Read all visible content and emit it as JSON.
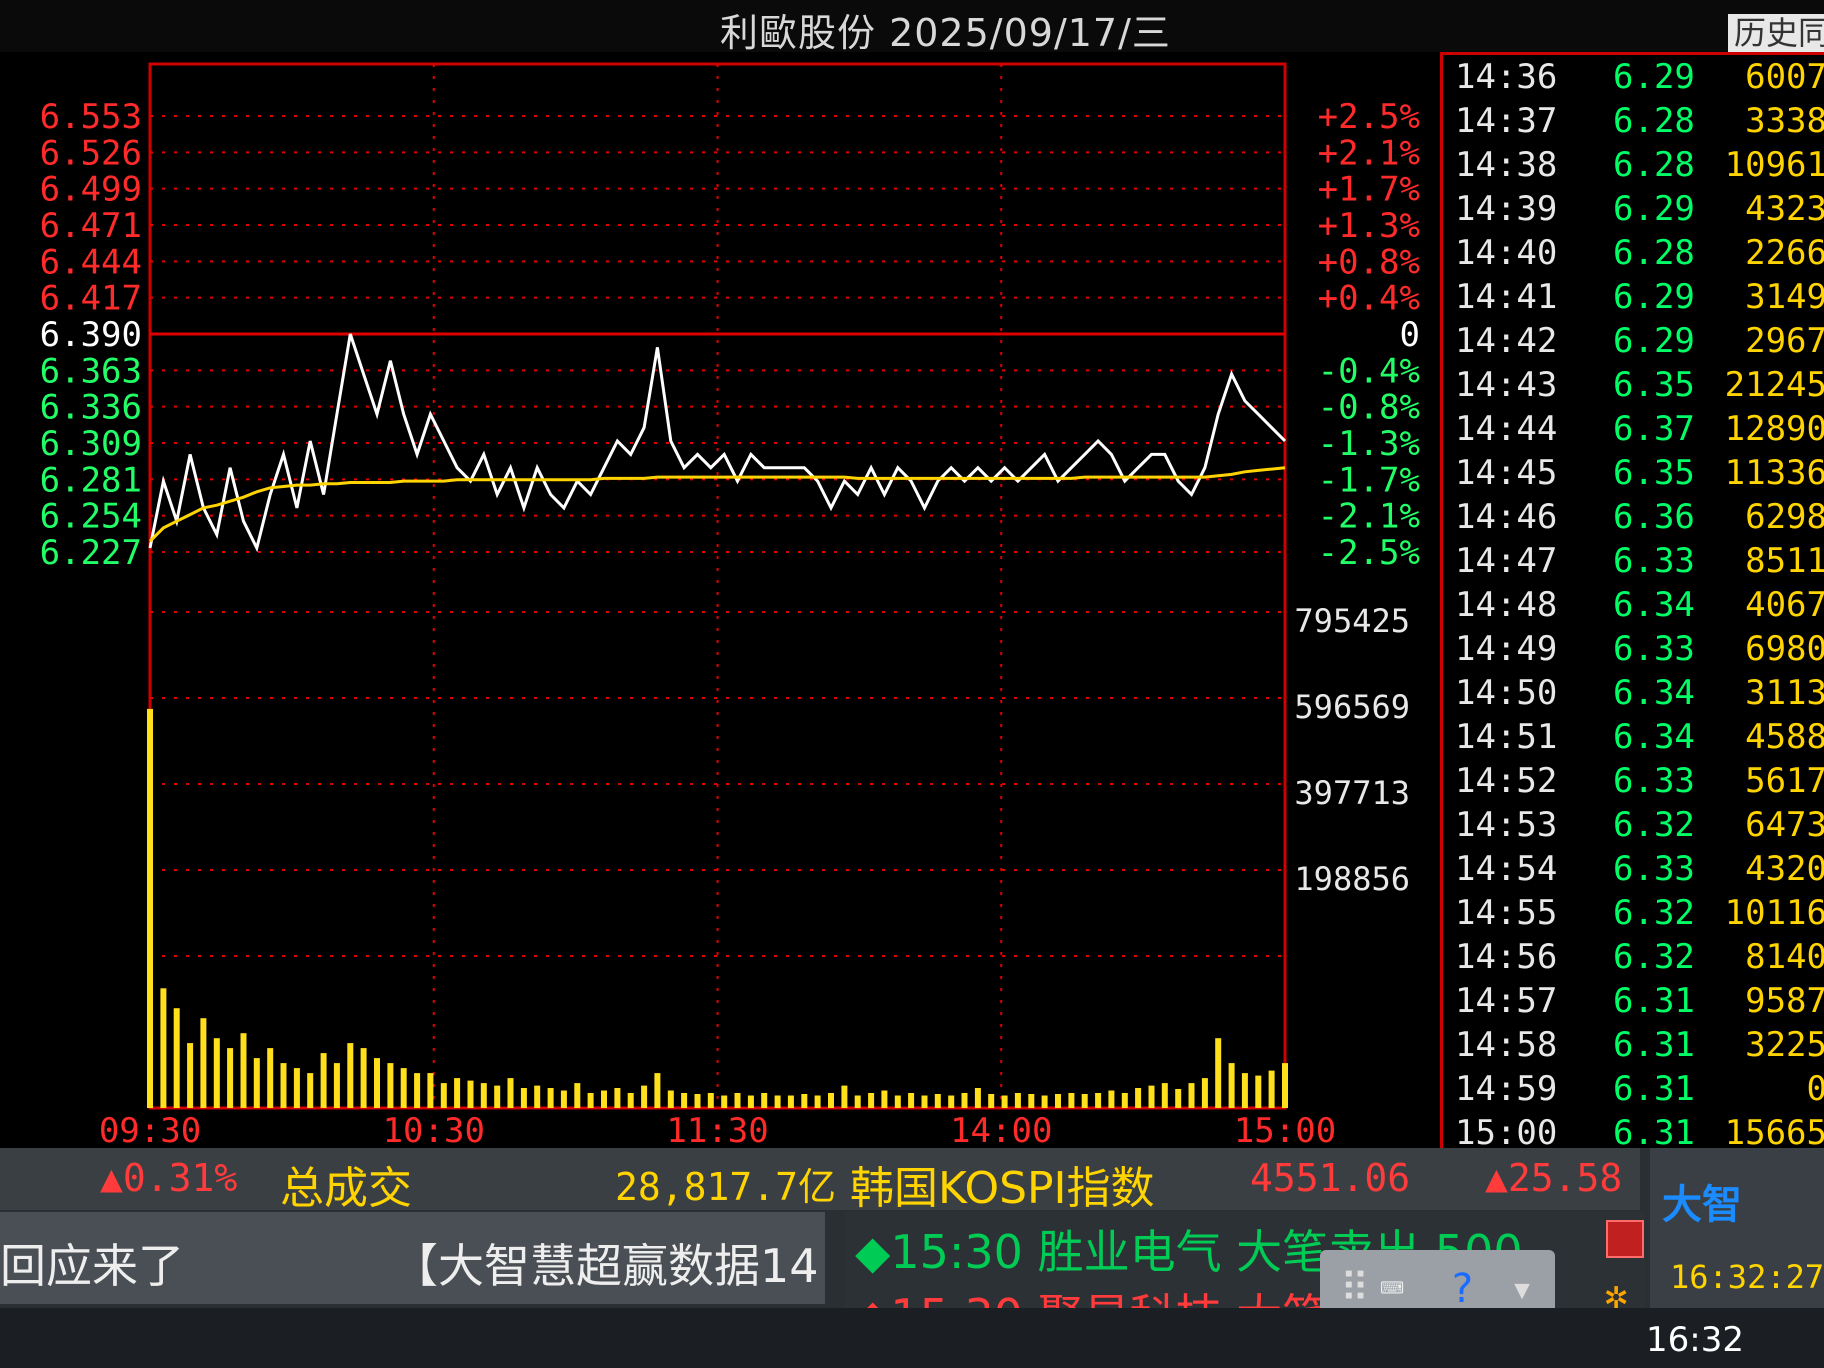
{
  "header": {
    "title": "利歐股份 2025/09/17/三",
    "history_tab": "历史同"
  },
  "chart_data": {
    "type": "line",
    "title": "利歐股份 2025/09/17/三",
    "prev_close": 6.39,
    "price_axis_left": {
      "up": [
        "6.553",
        "6.526",
        "6.499",
        "6.471",
        "6.444",
        "6.417"
      ],
      "ref": "6.390",
      "down": [
        "6.363",
        "6.336",
        "6.309",
        "6.281",
        "6.254",
        "6.227"
      ]
    },
    "pct_axis_right": {
      "up": [
        "+2.5%",
        "+2.1%",
        "+1.7%",
        "+1.3%",
        "+0.8%",
        "+0.4%"
      ],
      "ref": "0",
      "down": [
        "-0.4%",
        "-0.8%",
        "-1.3%",
        "-1.7%",
        "-2.1%",
        "-2.5%"
      ]
    },
    "volume_axis": [
      "795425",
      "596569",
      "397713",
      "198856"
    ],
    "x_labels": [
      "09:30",
      "10:30",
      "11:30",
      "14:00",
      "15:00"
    ],
    "ylim": [
      6.227,
      6.553
    ],
    "volume_max": 994281,
    "series": [
      {
        "color": "#ffffff",
        "values": [
          6.23,
          6.28,
          6.25,
          6.3,
          6.26,
          6.24,
          6.29,
          6.25,
          6.23,
          6.27,
          6.3,
          6.26,
          6.31,
          6.27,
          6.33,
          6.39,
          6.36,
          6.33,
          6.37,
          6.33,
          6.3,
          6.33,
          6.31,
          6.29,
          6.28,
          6.3,
          6.27,
          6.29,
          6.26,
          6.29,
          6.27,
          6.26,
          6.28,
          6.27,
          6.29,
          6.31,
          6.3,
          6.32,
          6.38,
          6.31,
          6.29,
          6.3,
          6.29,
          6.3,
          6.28,
          6.3,
          6.29,
          6.29,
          6.29,
          6.29,
          6.28,
          6.26,
          6.28,
          6.27,
          6.29,
          6.27,
          6.29,
          6.28,
          6.26,
          6.28,
          6.29,
          6.28,
          6.29,
          6.28,
          6.29,
          6.28,
          6.29,
          6.3,
          6.28,
          6.29,
          6.3,
          6.31,
          6.3,
          6.28,
          6.29,
          6.3,
          6.3,
          6.28,
          6.27,
          6.29,
          6.33,
          6.36,
          6.34,
          6.33,
          6.32,
          6.31
        ]
      },
      {
        "color": "#ffd400",
        "values": [
          6.235,
          6.245,
          6.25,
          6.255,
          6.26,
          6.262,
          6.265,
          6.268,
          6.272,
          6.275,
          6.276,
          6.277,
          6.277,
          6.278,
          6.278,
          6.279,
          6.279,
          6.279,
          6.279,
          6.28,
          6.28,
          6.28,
          6.28,
          6.281,
          6.281,
          6.281,
          6.281,
          6.281,
          6.281,
          6.281,
          6.281,
          6.281,
          6.281,
          6.281,
          6.282,
          6.282,
          6.282,
          6.282,
          6.283,
          6.283,
          6.283,
          6.283,
          6.283,
          6.283,
          6.283,
          6.283,
          6.283,
          6.283,
          6.283,
          6.283,
          6.283,
          6.283,
          6.283,
          6.282,
          6.282,
          6.282,
          6.282,
          6.282,
          6.282,
          6.282,
          6.282,
          6.282,
          6.282,
          6.282,
          6.282,
          6.282,
          6.282,
          6.282,
          6.282,
          6.282,
          6.283,
          6.283,
          6.283,
          6.283,
          6.283,
          6.283,
          6.283,
          6.283,
          6.283,
          6.283,
          6.284,
          6.285,
          6.287,
          6.288,
          6.289,
          6.29
        ]
      }
    ],
    "volume": [
      800000,
      240000,
      200000,
      130000,
      180000,
      140000,
      120000,
      150000,
      100000,
      120000,
      90000,
      80000,
      70000,
      110000,
      90000,
      130000,
      120000,
      100000,
      90000,
      80000,
      70000,
      70000,
      50000,
      60000,
      55000,
      50000,
      45000,
      60000,
      40000,
      45000,
      40000,
      35000,
      50000,
      30000,
      35000,
      40000,
      30000,
      45000,
      70000,
      35000,
      30000,
      28000,
      30000,
      25000,
      30000,
      25000,
      30000,
      25000,
      25000,
      28000,
      25000,
      30000,
      45000,
      25000,
      30000,
      35000,
      25000,
      30000,
      25000,
      28000,
      25000,
      30000,
      40000,
      28000,
      25000,
      30000,
      28000,
      25000,
      28000,
      30000,
      28000,
      30000,
      35000,
      30000,
      40000,
      45000,
      50000,
      38000,
      50000,
      60000,
      140000,
      90000,
      70000,
      65000,
      75000,
      90000
    ],
    "grid": true
  },
  "ticks": {
    "header": [
      "time",
      "price",
      "volume"
    ],
    "rows": [
      [
        "14:36",
        "6.29",
        "6007"
      ],
      [
        "14:37",
        "6.28",
        "3338"
      ],
      [
        "14:38",
        "6.28",
        "10961"
      ],
      [
        "14:39",
        "6.29",
        "4323"
      ],
      [
        "14:40",
        "6.28",
        "2266"
      ],
      [
        "14:41",
        "6.29",
        "3149"
      ],
      [
        "14:42",
        "6.29",
        "2967"
      ],
      [
        "14:43",
        "6.35",
        "21245"
      ],
      [
        "14:44",
        "6.37",
        "12890"
      ],
      [
        "14:45",
        "6.35",
        "11336"
      ],
      [
        "14:46",
        "6.36",
        "6298"
      ],
      [
        "14:47",
        "6.33",
        "8511"
      ],
      [
        "14:48",
        "6.34",
        "4067"
      ],
      [
        "14:49",
        "6.33",
        "6980"
      ],
      [
        "14:50",
        "6.34",
        "3113"
      ],
      [
        "14:51",
        "6.34",
        "4588"
      ],
      [
        "14:52",
        "6.33",
        "5617"
      ],
      [
        "14:53",
        "6.32",
        "6473"
      ],
      [
        "14:54",
        "6.33",
        "4320"
      ],
      [
        "14:55",
        "6.32",
        "10116"
      ],
      [
        "14:56",
        "6.32",
        "8140"
      ],
      [
        "14:57",
        "6.31",
        "9587"
      ],
      [
        "14:58",
        "6.31",
        "3225"
      ],
      [
        "14:59",
        "6.31",
        "0"
      ],
      [
        "15:00",
        "6.31",
        "15665"
      ]
    ]
  },
  "ticker": {
    "pct": "▲0.31%",
    "total_label": "总成交",
    "total_value": "28,817.7亿",
    "index_name": "韩国KOSPI指数",
    "index_value": "4551.06",
    "index_change": "▲25.58"
  },
  "news": {
    "left_1": "回应来了",
    "left_2": "【大智慧超赢数据14",
    "right_1": "◆15:30 胜业电气 大笔卖出 500",
    "right_2": "◆15:30 聚星科技 大笔"
  },
  "logo": {
    "text": "大智",
    "clock": "16:32:27"
  },
  "taskbar": {
    "clock": "16:32"
  },
  "toolbox": {
    "help": "?"
  }
}
